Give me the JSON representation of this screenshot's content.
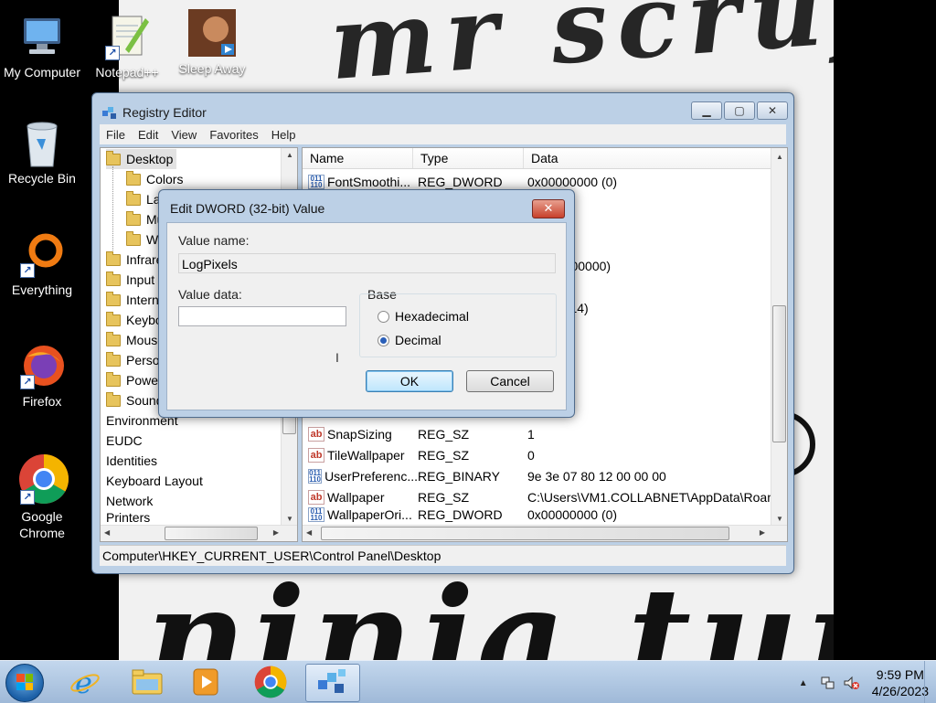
{
  "wallpaper": {
    "text_top": "mr scruff",
    "text_bottom": "ninja tuna"
  },
  "desktop_icons": [
    {
      "label": "My Computer"
    },
    {
      "label": "Notepad++"
    },
    {
      "label": "Sleep Away"
    },
    {
      "label": "Recycle Bin"
    },
    {
      "label": "Everything"
    },
    {
      "label": "Firefox"
    },
    {
      "label": "Google Chrome"
    }
  ],
  "registry": {
    "title": "Registry Editor",
    "menu": [
      "File",
      "Edit",
      "View",
      "Favorites",
      "Help"
    ],
    "tree": [
      {
        "label": "Desktop",
        "level": 0,
        "selected": true
      },
      {
        "label": "Colors",
        "level": 1
      },
      {
        "label": "La",
        "level": 1
      },
      {
        "label": "Mu",
        "level": 1
      },
      {
        "label": "Wi",
        "level": 1
      },
      {
        "label": "Infrare",
        "level": 0
      },
      {
        "label": "Input",
        "level": 0
      },
      {
        "label": "Intern",
        "level": 0
      },
      {
        "label": "Keybo",
        "level": 0
      },
      {
        "label": "Mouse",
        "level": 0
      },
      {
        "label": "Person",
        "level": 0
      },
      {
        "label": "Power",
        "level": 0
      },
      {
        "label": "Sound",
        "level": 0
      },
      {
        "label": "Environment",
        "level": -1
      },
      {
        "label": "EUDC",
        "level": -1
      },
      {
        "label": "Identities",
        "level": -1
      },
      {
        "label": "Keyboard Layout",
        "level": -1
      },
      {
        "label": "Network",
        "level": -1
      },
      {
        "label": "Printers",
        "level": -1
      }
    ],
    "columns": [
      "Name",
      "Type",
      "Data"
    ],
    "rows": [
      {
        "icon": "dword",
        "name": "FontSmoothi...",
        "type": "REG_DWORD",
        "data": "0x00000000 (0)"
      },
      {
        "icon": "",
        "name": "",
        "type": "",
        "data": "0001 (1)"
      },
      {
        "icon": "",
        "name": "",
        "type": "",
        "data": "0002 (2)"
      },
      {
        "icon": "",
        "name": "",
        "type": "",
        "data": "0007 (7)"
      },
      {
        "icon": "",
        "name": "",
        "type": "",
        "data": "0d40 (200000)"
      },
      {
        "icon": "",
        "name": "",
        "type": "",
        "data": ""
      },
      {
        "icon": "",
        "name": "",
        "type": "",
        "data": "0072 (114)"
      },
      {
        "icon": "",
        "name": "",
        "type": "",
        "data": ""
      },
      {
        "icon": "",
        "name": "",
        "type": "",
        "data": "0000 (0)"
      },
      {
        "icon": "",
        "name": "",
        "type": "",
        "data": "0000 (0)"
      },
      {
        "icon": "",
        "name": "",
        "type": "",
        "data": ""
      },
      {
        "icon": "",
        "name": "",
        "type": "",
        "data": ""
      },
      {
        "icon": "sz",
        "name": "SnapSizing",
        "type": "REG_SZ",
        "data": "1"
      },
      {
        "icon": "sz",
        "name": "TileWallpaper",
        "type": "REG_SZ",
        "data": "0"
      },
      {
        "icon": "dword",
        "name": "UserPreferenc...",
        "type": "REG_BINARY",
        "data": "9e 3e 07 80 12 00 00 00"
      },
      {
        "icon": "sz",
        "name": "Wallpaper",
        "type": "REG_SZ",
        "data": "C:\\Users\\VM1.COLLABNET\\AppData\\Roam"
      },
      {
        "icon": "dword",
        "name": "WallpaperOri...",
        "type": "REG_DWORD",
        "data": "0x00000000 (0)"
      }
    ],
    "status_path": "Computer\\HKEY_CURRENT_USER\\Control Panel\\Desktop"
  },
  "dialog": {
    "title": "Edit DWORD (32-bit) Value",
    "value_name_label": "Value name:",
    "value_name": "LogPixels",
    "value_data_label": "Value data:",
    "value_data": "",
    "base_label": "Base",
    "options": [
      {
        "label": "Hexadecimal",
        "selected": false
      },
      {
        "label": "Decimal",
        "selected": true
      }
    ],
    "ok_label": "OK",
    "cancel_label": "Cancel"
  },
  "taskbar": {
    "time": "9:59 PM",
    "date": "4/26/2023"
  },
  "icon_names": {
    "start": "windows-start-icon",
    "ie": "internet-explorer-icon",
    "explorer": "file-explorer-icon",
    "media": "media-player-icon",
    "chrome": "chrome-icon",
    "regedit": "registry-editor-icon"
  }
}
